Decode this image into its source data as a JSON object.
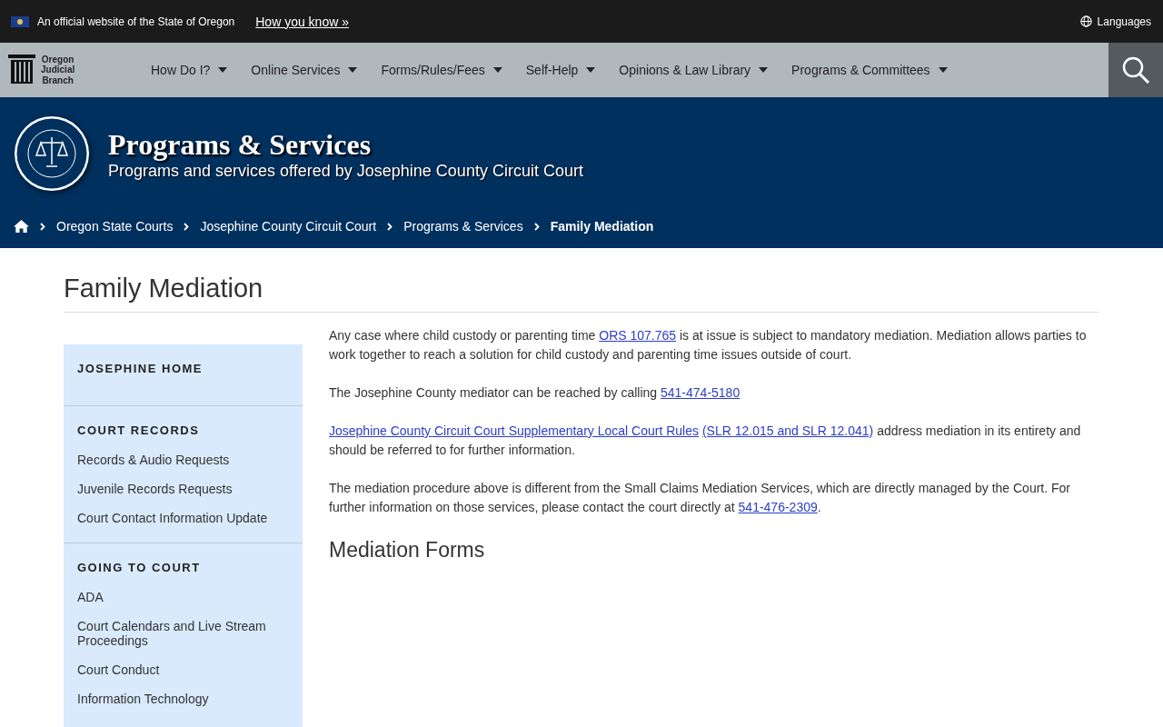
{
  "official_banner": {
    "text": "An official website of the State of Oregon",
    "link": "How you know »",
    "languages": "Languages"
  },
  "logo": {
    "lines": [
      "Oregon",
      "Judicial",
      "Branch"
    ]
  },
  "nav": [
    {
      "label": "How Do I?"
    },
    {
      "label": "Online Services"
    },
    {
      "label": "Forms/Rules/Fees"
    },
    {
      "label": "Self-Help"
    },
    {
      "label": "Opinions & Law Library"
    },
    {
      "label": "Programs & Committees"
    }
  ],
  "header": {
    "title": "Programs & Services",
    "subtitle": "Programs and services offered by Josephine County Circuit Court"
  },
  "breadcrumb": [
    {
      "label": "Oregon State Courts",
      "current": false
    },
    {
      "label": "Josephine County Circuit Court",
      "current": false
    },
    {
      "label": "Programs & Services",
      "current": false
    },
    {
      "label": "Family Mediation",
      "current": true
    }
  ],
  "page_title": "Family Mediation",
  "sidebar": [
    {
      "kind": "heading",
      "label": "JOSEPHINE HOME"
    },
    {
      "kind": "heading",
      "label": "COURT RECORDS"
    },
    {
      "kind": "link",
      "label": "Records & Audio Requests"
    },
    {
      "kind": "link",
      "label": "Juvenile Records Requests"
    },
    {
      "kind": "link",
      "label": "Court Contact Information Update"
    },
    {
      "kind": "heading",
      "label": "GOING TO COURT"
    },
    {
      "kind": "link",
      "label": "ADA"
    },
    {
      "kind": "link",
      "label": "Court Calendars and Live Stream Proceedings"
    },
    {
      "kind": "link",
      "label": "Court Conduct"
    },
    {
      "kind": "link",
      "label": "Information Technology"
    }
  ],
  "paragraphs": [
    [
      {
        "text": "Any case where child custody or parenting time ",
        "link": false
      },
      {
        "text": "ORS 107.765",
        "link": true
      },
      {
        "text": " is at issue is subject to mandatory mediation. Mediation allows parties to work together to reach a solution for child custody and parenting time issues outside of court.",
        "link": false
      }
    ],
    [
      {
        "text": "The Josephine County mediator can be reached by calling ",
        "link": false
      },
      {
        "text": "541-474-5180",
        "link": true
      }
    ],
    [
      {
        "text": "Josephine County Circuit Court Supplementary Local Court Rules",
        "link": true
      },
      {
        "text": "(SLR 12.015 and SLR 12.041)",
        "link": true
      },
      {
        "text": " address mediation in its entirety and should be referred to for further information.",
        "link": false
      }
    ],
    [
      {
        "text": "The mediation procedure above is different from the Small Claims Mediation Services, which are directly managed by the Court. For further information on those services, please contact the court directly at ",
        "link": false
      },
      {
        "text": "541-476-2309",
        "link": true
      },
      {
        "text": ".",
        "link": false
      }
    ]
  ],
  "section_heading": "Mediation Forms"
}
